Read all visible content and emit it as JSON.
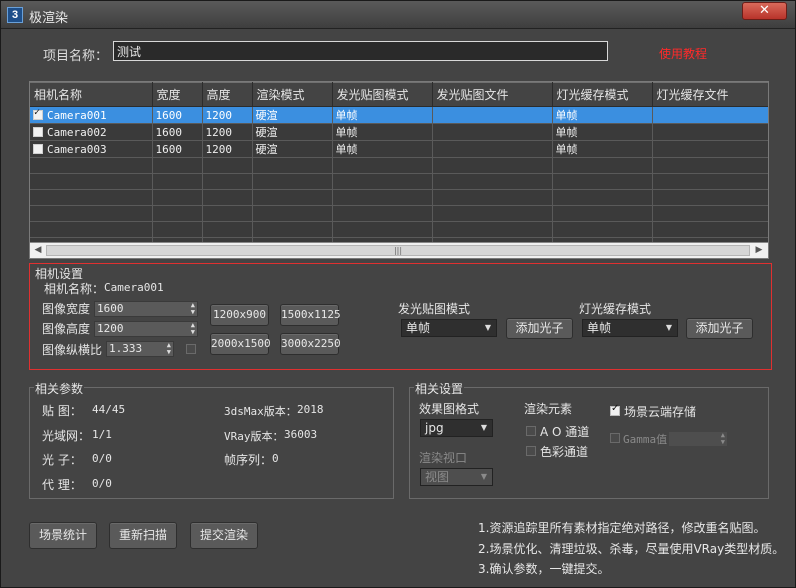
{
  "window": {
    "title": "极渲染",
    "app_icon": "3",
    "close_glyph": "✕"
  },
  "project": {
    "label": "项目名称：",
    "value": "测试",
    "error": "使用教程"
  },
  "table": {
    "columns": [
      "相机名称",
      "宽度",
      "高度",
      "渲染模式",
      "发光贴图模式",
      "发光贴图文件",
      "灯光缓存模式",
      "灯光缓存文件"
    ],
    "rows": [
      {
        "checked": true,
        "selected": true,
        "name": "Camera001",
        "width": "1600",
        "height": "1200",
        "render_mode": "硬渲",
        "irr_mode": "单帧",
        "irr_file": "",
        "lc_mode": "单帧",
        "lc_file": ""
      },
      {
        "checked": false,
        "selected": false,
        "name": "Camera002",
        "width": "1600",
        "height": "1200",
        "render_mode": "硬渲",
        "irr_mode": "单帧",
        "irr_file": "",
        "lc_mode": "单帧",
        "lc_file": ""
      },
      {
        "checked": false,
        "selected": false,
        "name": "Camera003",
        "width": "1600",
        "height": "1200",
        "render_mode": "硬渲",
        "irr_mode": "单帧",
        "irr_file": "",
        "lc_mode": "单帧",
        "lc_file": ""
      }
    ],
    "empty_rows": 6,
    "scroll_thumb": "|||"
  },
  "camera_settings": {
    "title": "相机设置",
    "camera_name_label": "相机名称：",
    "camera_name_value": "Camera001",
    "width_label": "图像宽度",
    "width_value": "1600",
    "height_label": "图像高度",
    "height_value": "1200",
    "aspect_label": "图像纵横比",
    "aspect_value": "1.333",
    "presets": [
      "1200x900",
      "1500x1125",
      "2000x1500",
      "3000x2250"
    ],
    "irr_mode_label": "发光贴图模式",
    "irr_mode_value": "单帧",
    "irr_add_button": "添加光子",
    "lc_mode_label": "灯光缓存模式",
    "lc_mode_value": "单帧",
    "lc_add_button": "添加光子"
  },
  "related_params": {
    "title": "相关参数",
    "maps_label": "贴  图：",
    "maps_value": "44/45",
    "ies_label": "光域网：",
    "ies_value": "1/1",
    "photon_label": "光  子：",
    "photon_value": "0/0",
    "proxy_label": "代  理：",
    "proxy_value": "0/0",
    "max_version_label": "3dsMax版本：",
    "max_version_value": "2018",
    "vray_version_label": "VRay版本：",
    "vray_version_value": "36003",
    "frames_label": "帧序列：",
    "frames_value": "0"
  },
  "related_settings": {
    "title": "相关设置",
    "format_label": "效果图格式",
    "format_value": "jpg",
    "viewport_label": "渲染视口",
    "viewport_value": "视图",
    "elements_label": "渲染元素",
    "ao_label": "A O 通道",
    "color_label": "色彩通道",
    "cloud_label": "场景云端存储",
    "cloud_checked": true,
    "gamma_label": "Gamma值"
  },
  "buttons": {
    "stats": "场景统计",
    "rescan": "重新扫描",
    "submit": "提交渲染"
  },
  "notes": [
    "1.资源追踪里所有素材指定绝对路径，修改重名贴图。",
    "2.场景优化、清理垃圾、杀毒，尽量使用VRay类型材质。",
    "3.确认参数，一键提交。"
  ]
}
